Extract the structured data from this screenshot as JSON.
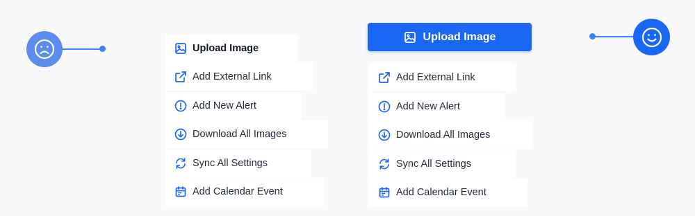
{
  "colors": {
    "accent": "#1a66f5",
    "connector": "#3b82f6",
    "sad_face": "#5b8def",
    "happy_face": "#1a66f5",
    "background": "#f9f9fb"
  },
  "left_example": {
    "face_icon": "sad-face-icon",
    "menu": {
      "items": [
        {
          "label": "Upload Image",
          "icon": "image-icon"
        },
        {
          "label": "Add External Link",
          "icon": "external-link-icon"
        },
        {
          "label": "Add New Alert",
          "icon": "alert-circle-icon"
        },
        {
          "label": "Download All Images",
          "icon": "download-circle-icon"
        },
        {
          "label": "Sync All Settings",
          "icon": "sync-icon"
        },
        {
          "label": "Add Calendar Event",
          "icon": "calendar-icon"
        }
      ]
    }
  },
  "right_example": {
    "face_icon": "happy-face-icon",
    "primary_button": {
      "label": "Upload Image",
      "icon": "image-icon"
    },
    "menu": {
      "items": [
        {
          "label": "Add External Link",
          "icon": "external-link-icon"
        },
        {
          "label": "Add New Alert",
          "icon": "alert-circle-icon"
        },
        {
          "label": "Download All Images",
          "icon": "download-circle-icon"
        },
        {
          "label": "Sync All Settings",
          "icon": "sync-icon"
        },
        {
          "label": "Add Calendar Event",
          "icon": "calendar-icon"
        }
      ]
    }
  }
}
